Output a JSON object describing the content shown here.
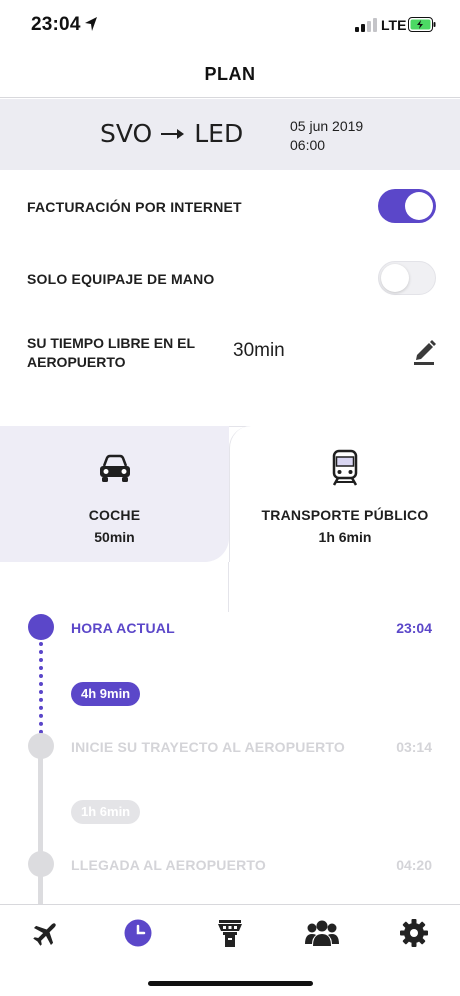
{
  "status_bar": {
    "time": "23:04",
    "network": "LTE"
  },
  "header": {
    "title": "PLAN"
  },
  "route": {
    "from": "SVO",
    "to": "LED",
    "date": "05 jun 2019",
    "time": "06:00"
  },
  "settings": {
    "online_checkin": {
      "label": "FACTURACIÓN POR INTERNET",
      "enabled": true
    },
    "hand_luggage": {
      "label": "SOLO EQUIPAJE DE MANO",
      "enabled": false
    },
    "free_time": {
      "label": "SU TIEMPO LIBRE EN EL AEROPUERTO",
      "value": "30min"
    }
  },
  "transport_tabs": [
    {
      "label": "COCHE",
      "duration": "50min",
      "icon": "car-icon",
      "selected": true
    },
    {
      "label": "TRANSPORTE PÚBLICO",
      "duration": "1h 6min",
      "icon": "train-icon",
      "selected": false
    }
  ],
  "timeline": [
    {
      "label": "HORA ACTUAL",
      "time": "23:04",
      "active": true
    },
    {
      "gap": "4h 9min",
      "active": true
    },
    {
      "label": "INICIE SU TRAYECTO AL AEROPUERTO",
      "time": "03:14",
      "active": false
    },
    {
      "gap": "1h 6min",
      "active": false
    },
    {
      "label": "LLEGADA AL AEROPUERTO",
      "time": "04:20",
      "active": false
    }
  ],
  "bottom_nav": [
    {
      "icon": "plane-icon",
      "active": false
    },
    {
      "icon": "clock-icon",
      "active": true
    },
    {
      "icon": "control-tower-icon",
      "active": false
    },
    {
      "icon": "people-icon",
      "active": false
    },
    {
      "icon": "gear-icon",
      "active": false
    }
  ],
  "colors": {
    "accent": "#5b47c9",
    "inactive": "#d4d4d8",
    "band": "#ececf2",
    "battery": "#4cd964"
  }
}
